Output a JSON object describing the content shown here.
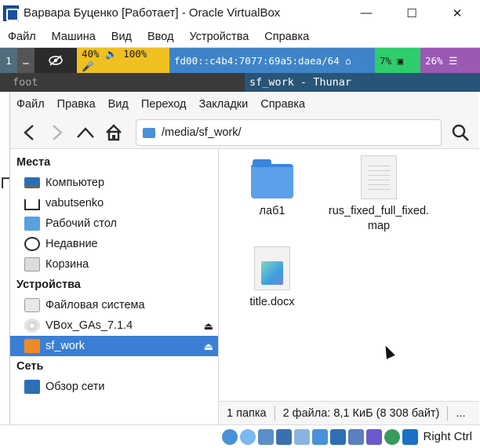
{
  "window": {
    "title": "Варвара Буценко [Работает] - Oracle VirtualBox",
    "minimize": "—",
    "maximize": "☐",
    "close": "✕"
  },
  "vbox_menu": [
    "Файл",
    "Машина",
    "Вид",
    "Ввод",
    "Устройства",
    "Справка"
  ],
  "waybar": {
    "ws1": "1",
    "ws2": "…",
    "audio": "40% 🔈 100% 🎤",
    "network": "fd00::c4b4:7077:69a5:daea/64 ⌂",
    "cpu": "7% ▣",
    "memory": "26% ☰",
    "colors": {
      "audio": "#f0c020",
      "network": "#3f84c8",
      "cpu": "#2ecc6b",
      "memory": "#9b59b6"
    }
  },
  "sway_tabs": {
    "inactive": "foot",
    "active": "sf_work - Thunar"
  },
  "thunar": {
    "menu": [
      "Файл",
      "Правка",
      "Вид",
      "Переход",
      "Закладки",
      "Справка"
    ],
    "path": "/media/sf_work/",
    "sidebar": {
      "places_header": "Места",
      "places": [
        {
          "label": "Компьютер",
          "icon": "computer-icon"
        },
        {
          "label": "vabutsenko",
          "icon": "home-icon"
        },
        {
          "label": "Рабочий стол",
          "icon": "desktop-icon"
        },
        {
          "label": "Недавние",
          "icon": "recent-icon"
        },
        {
          "label": "Корзина",
          "icon": "trash-icon"
        }
      ],
      "devices_header": "Устройства",
      "devices": [
        {
          "label": "Файловая система",
          "icon": "disk-icon"
        },
        {
          "label": "VBox_GAs_7.1.4",
          "icon": "cd-icon"
        },
        {
          "label": "sf_work",
          "icon": "shared-folder-icon"
        }
      ],
      "network_header": "Сеть",
      "network": [
        {
          "label": "Обзор сети",
          "icon": "network-icon"
        }
      ]
    },
    "files": [
      {
        "name": "лаб1",
        "type": "folder"
      },
      {
        "name": "rus_fixed_full_fixed.map",
        "type": "document"
      },
      {
        "name": "title.docx",
        "type": "docx"
      }
    ],
    "status": {
      "folders": "1 папка",
      "files": "2 файла: 8,1 КиБ (8 308 байт)",
      "more": "..."
    }
  },
  "vbox_status": {
    "host_key": "Right Ctrl"
  }
}
